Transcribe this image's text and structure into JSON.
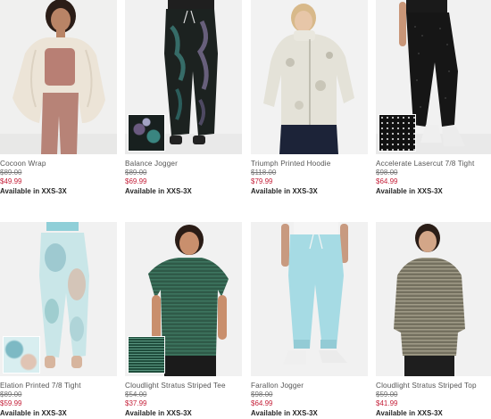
{
  "products": [
    {
      "name": "Cocoon Wrap",
      "original_price": "$89.00",
      "sale_price": "$49.99",
      "availability": "Available in XXS-3X"
    },
    {
      "name": "Balance Jogger",
      "original_price": "$89.00",
      "sale_price": "$69.99",
      "availability": "Available in XXS-3X"
    },
    {
      "name": "Triumph Printed Hoodie",
      "original_price": "$118.00",
      "sale_price": "$79.99",
      "availability": "Available in XXS-3X"
    },
    {
      "name": "Accelerate Lasercut 7/8 Tight",
      "original_price": "$98.00",
      "sale_price": "$64.99",
      "availability": "Available in XXS-3X"
    },
    {
      "name": "Elation Printed 7/8 Tight",
      "original_price": "$89.00",
      "sale_price": "$59.99",
      "availability": "Available in XXS-3X"
    },
    {
      "name": "Cloudlight Stratus Striped Tee",
      "original_price": "$54.00",
      "sale_price": "$37.99",
      "availability": "Available in XXS-3X"
    },
    {
      "name": "Farallon Jogger",
      "original_price": "$98.00",
      "sale_price": "$64.99",
      "availability": "Available in XXS-3X"
    },
    {
      "name": "Cloudlight Stratus Striped Top",
      "original_price": "$59.00",
      "sale_price": "$41.99",
      "availability": "Available in XXS-3X"
    }
  ],
  "colors": {
    "sale_price": "#c5223b",
    "background": "#ffffff",
    "photo_background": "#f1f2f2"
  }
}
